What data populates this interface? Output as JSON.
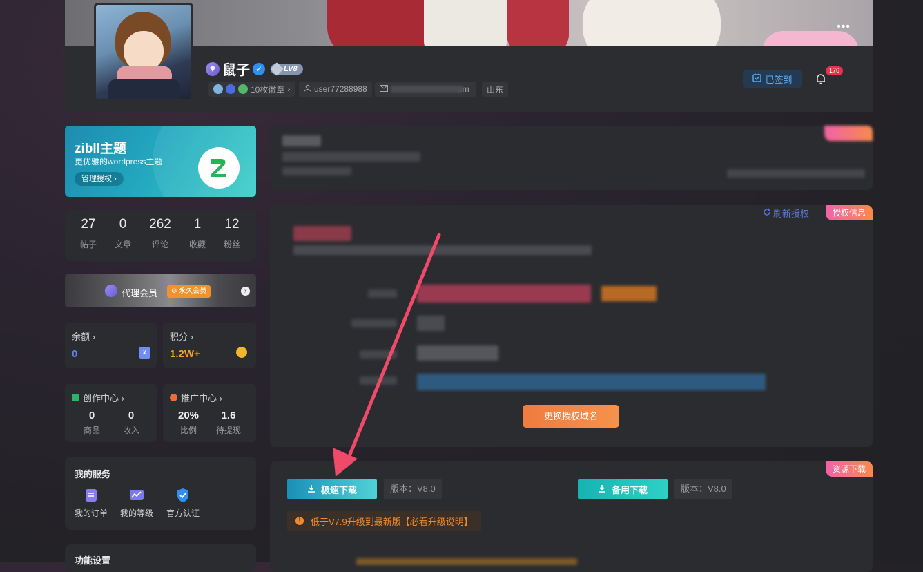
{
  "header": {
    "username": "鼠子",
    "level": "LV8",
    "medals_label": "10枚徽章",
    "user_id": "user77288988",
    "email_suffix": "om",
    "location": "山东",
    "signed_label": "已签到",
    "notification_count": "176"
  },
  "promo": {
    "title": "zibll主题",
    "subtitle": "更优雅的wordpress主题",
    "button_label": "管理授权"
  },
  "stats": [
    {
      "value": "27",
      "label": "帖子"
    },
    {
      "value": "0",
      "label": "文章"
    },
    {
      "value": "262",
      "label": "评论"
    },
    {
      "value": "1",
      "label": "收藏"
    },
    {
      "value": "12",
      "label": "粉丝"
    }
  ],
  "membership": {
    "label": "代理会员",
    "tag": "永久会员"
  },
  "wallet": {
    "balance_label": "余额",
    "balance_value": "0",
    "points_label": "积分",
    "points_value": "1.2W+"
  },
  "creator": {
    "label": "创作中心",
    "items": [
      {
        "value": "0",
        "label": "商品"
      },
      {
        "value": "0",
        "label": "收入"
      }
    ]
  },
  "promotion": {
    "label": "推广中心",
    "items": [
      {
        "value": "20%",
        "label": "比例"
      },
      {
        "value": "1.6",
        "label": "待提现"
      }
    ]
  },
  "services": {
    "title": "我的服务",
    "items": [
      {
        "label": "我的订单",
        "icon": "order-icon"
      },
      {
        "label": "我的等级",
        "icon": "level-chart-icon"
      },
      {
        "label": "官方认证",
        "icon": "verified-shield-icon"
      }
    ]
  },
  "settings": {
    "title": "功能设置"
  },
  "auth_panel": {
    "refresh_label": "刷新授权",
    "tag": "授权信息",
    "change_domain_label": "更换授权域名"
  },
  "download_panel": {
    "tag": "资源下载",
    "fast_label": "极速下载",
    "backup_label": "备用下载",
    "version_label": "版本：V8.0",
    "backup_version_label": "版本：V8.0",
    "notice": "低于V7.9升级到最新版【必看升级说明】"
  },
  "colors": {
    "accent_blue": "#2f8ff3",
    "orange": "#f0932c",
    "teal": "#1fb8c0",
    "pink_tag": "#f262a8"
  }
}
